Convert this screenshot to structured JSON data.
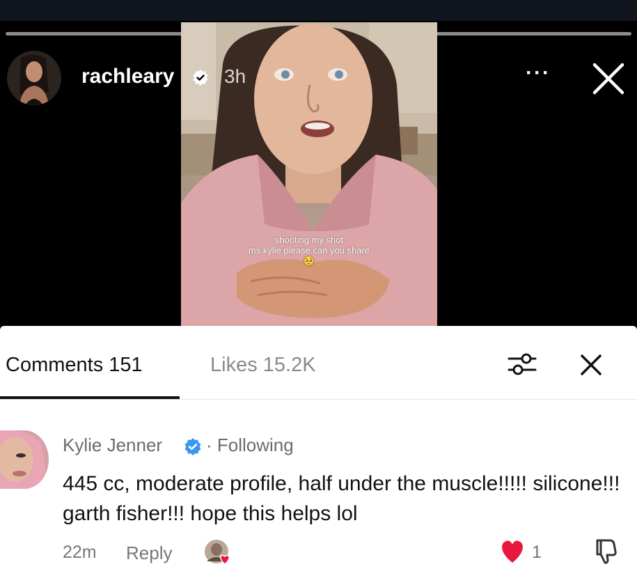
{
  "story": {
    "username": "rachleary",
    "time_ago": "3h",
    "more_label": "···",
    "caption_line1": "shooting my shot",
    "caption_line2": "ms kylie please can you share",
    "caption_emoji": "🥺"
  },
  "comments_panel": {
    "tab_comments": "Comments 151",
    "tab_likes": "Likes 15.2K",
    "active_tab": "comments"
  },
  "comment": {
    "author": "Kylie Jenner",
    "following_label": "· Following",
    "text": "445 cc, moderate profile, half under the muscle!!!!! silicone!!! garth fisher!!! hope this helps lol",
    "time": "22m",
    "reply_label": "Reply",
    "like_count": "1",
    "liked": true
  },
  "colors": {
    "verified_blue": "#3897f0",
    "heart_red": "#e8173c",
    "muted_text": "#777777",
    "active_tab_underline": "#111111"
  }
}
